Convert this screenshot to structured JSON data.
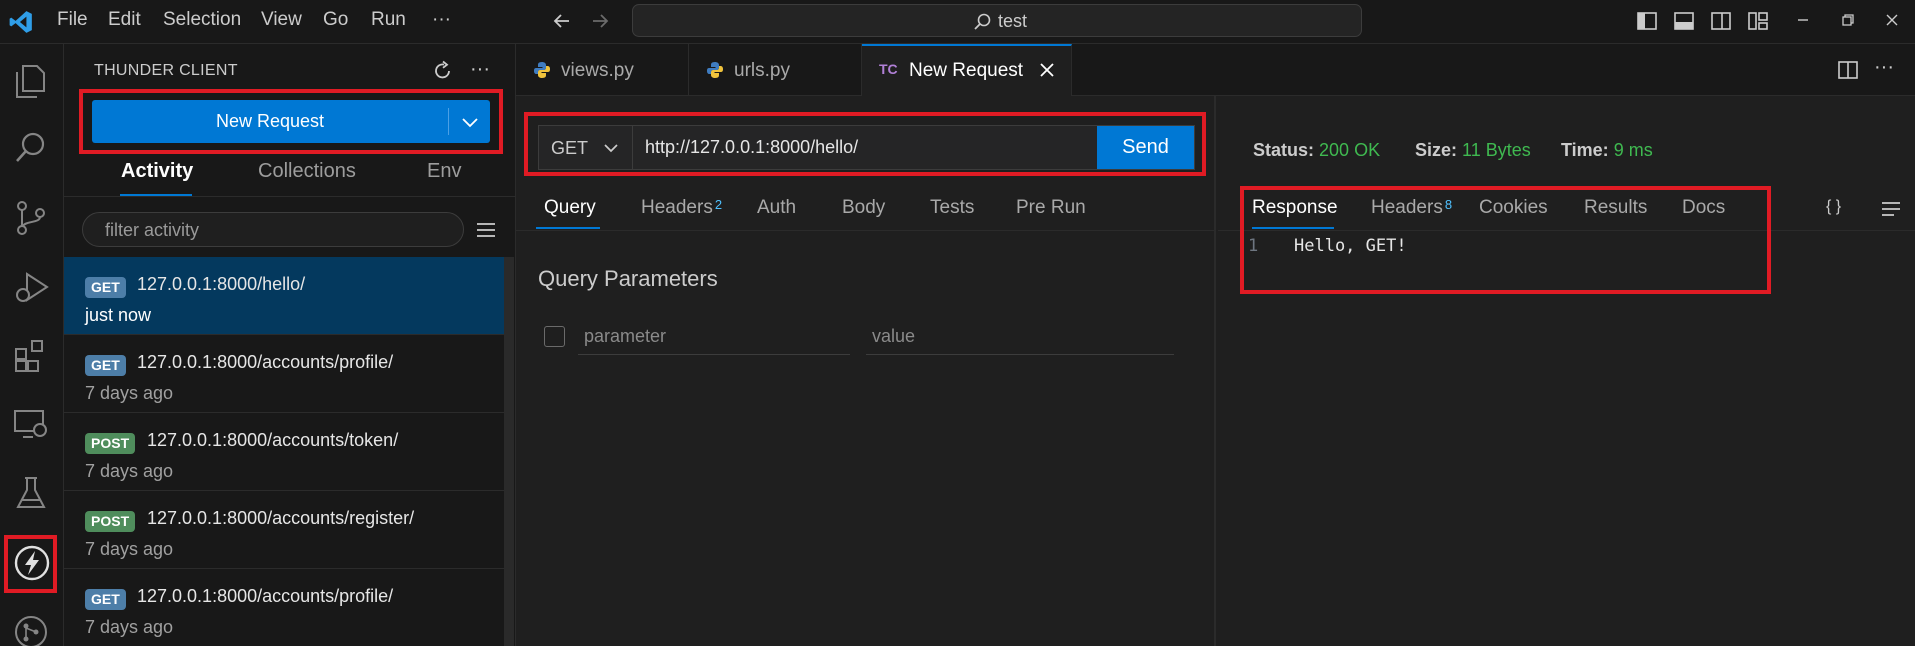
{
  "menu": {
    "items": [
      "File",
      "Edit",
      "Selection",
      "View",
      "Go",
      "Run"
    ],
    "more": "···"
  },
  "search": {
    "text": "test"
  },
  "activity_bar": {
    "icons": [
      "explorer-icon",
      "search-icon",
      "source-control-icon",
      "run-debug-icon",
      "extensions-icon",
      "remote-explorer-icon",
      "testing-icon",
      "thunder-client-icon",
      "git-graph-icon"
    ],
    "active": "thunder-client-icon"
  },
  "sidebar": {
    "title": "THUNDER CLIENT",
    "new_request_label": "New Request",
    "tabs": [
      "Activity",
      "Collections",
      "Env"
    ],
    "active_tab": "Activity",
    "filter_placeholder": "filter activity",
    "activity": [
      {
        "method": "GET",
        "url": "127.0.0.1:8000/hello/",
        "time": "just now",
        "selected": true
      },
      {
        "method": "GET",
        "url": "127.0.0.1:8000/accounts/profile/",
        "time": "7 days ago"
      },
      {
        "method": "POST",
        "url": "127.0.0.1:8000/accounts/token/",
        "time": "7 days ago"
      },
      {
        "method": "POST",
        "url": "127.0.0.1:8000/accounts/register/",
        "time": "7 days ago"
      },
      {
        "method": "GET",
        "url": "127.0.0.1:8000/accounts/profile/",
        "time": "7 days ago"
      }
    ]
  },
  "editor_tabs": [
    {
      "label": "views.py",
      "icon": "python-icon"
    },
    {
      "label": "urls.py",
      "icon": "python-icon"
    },
    {
      "label": "New Request",
      "icon_text": "TC",
      "active": true
    }
  ],
  "request": {
    "method": "GET",
    "url": "http://127.0.0.1:8000/hello/",
    "send_label": "Send",
    "tabs": [
      {
        "label": "Query",
        "active": true
      },
      {
        "label": "Headers",
        "count": "2"
      },
      {
        "label": "Auth"
      },
      {
        "label": "Body"
      },
      {
        "label": "Tests"
      },
      {
        "label": "Pre Run"
      }
    ],
    "query_title": "Query Parameters",
    "param_placeholder": "parameter",
    "value_placeholder": "value"
  },
  "response": {
    "status_label": "Status:",
    "status_value": "200 OK",
    "size_label": "Size:",
    "size_value": "11 Bytes",
    "time_label": "Time:",
    "time_value": "9 ms",
    "tabs": [
      {
        "label": "Response",
        "active": true
      },
      {
        "label": "Headers",
        "count": "8"
      },
      {
        "label": "Cookies"
      },
      {
        "label": "Results"
      },
      {
        "label": "Docs"
      }
    ],
    "format_label": "{ }",
    "line_number": "1",
    "body": "Hello, GET!"
  },
  "colors": {
    "accent": "#0078d4",
    "highlight": "#e01b24",
    "success": "#3fb950"
  }
}
